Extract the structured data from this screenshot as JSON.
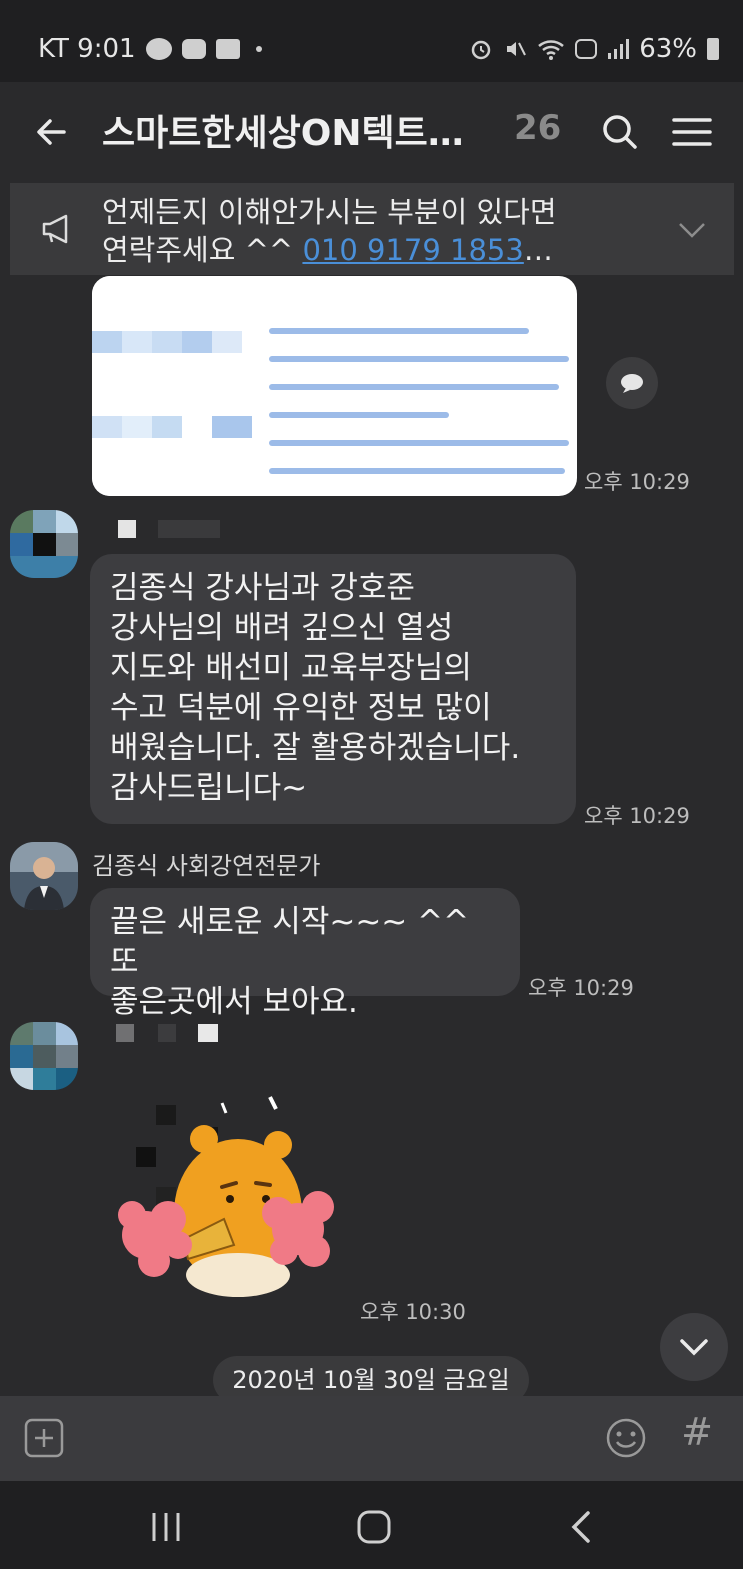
{
  "status_bar": {
    "carrier_time": "KT 9:01",
    "battery": "63%",
    "left_icons": [
      "talk-icon",
      "youtube-icon",
      "gallery-icon"
    ],
    "right_icons": [
      "alarm-icon",
      "mute-icon",
      "wifi-icon",
      "hd-icon",
      "signal-icon",
      "battery-icon"
    ]
  },
  "header": {
    "title": "스마트한세상ON텍트…",
    "member_count": "26",
    "icons": [
      "back-arrow-icon",
      "search-icon",
      "menu-icon"
    ]
  },
  "notice": {
    "text_line1": "언제든지 이해안가시는 부분이 있다면",
    "text_line2_prefix": "연락주세요 ^^ ",
    "phone": "010 9179 1853",
    "ellipsis": "…",
    "icons": [
      "megaphone-icon",
      "chevron-down-icon"
    ]
  },
  "messages": [
    {
      "type": "image",
      "time": "오후 10:29"
    },
    {
      "type": "text",
      "lines": [
        "김종식 강사님과 강호준",
        "강사님의 배려 깊으신 열성",
        "지도와 배선미 교육부장님의",
        "수고 덕분에 유익한 정보 많이",
        "배웠습니다. 잘 활용하겠습니다.",
        "감사드립니다~"
      ],
      "time": "오후 10:29"
    },
    {
      "type": "text",
      "sender": "김종식 사회강연전문가",
      "lines": [
        "끝은 새로운 시작~~~ ^^ 또",
        "좋은곳에서 보아요."
      ],
      "time": "오후 10:29"
    },
    {
      "type": "sticker",
      "time": "오후 10:30"
    }
  ],
  "date_divider": "2020년 10월 30일 금요일",
  "input_bar": {
    "hash_label": "#",
    "icons": [
      "add-icon",
      "emoji-icon"
    ]
  },
  "nav_bar": {
    "icons": [
      "recents-icon",
      "home-icon",
      "back-icon"
    ]
  },
  "colors": {
    "background": "#2a2a2c",
    "bubble": "#3d3d40",
    "link": "#4a8fd8",
    "sticker_bear": "#f0a020",
    "pompom": "#f07a86"
  }
}
